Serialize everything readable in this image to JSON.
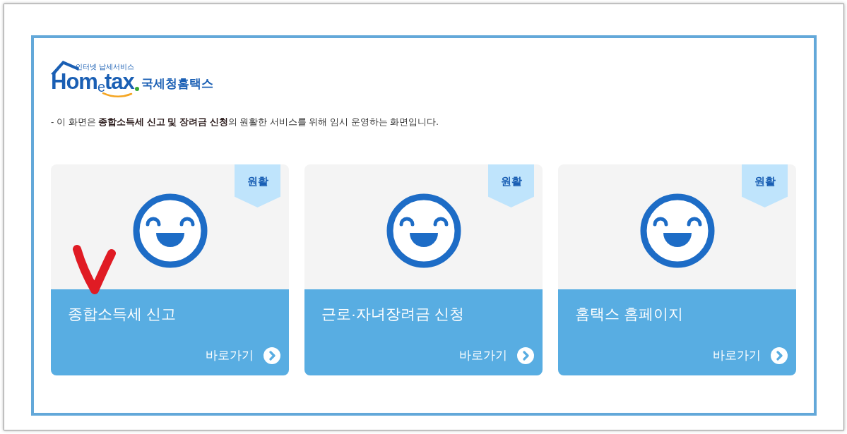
{
  "logo": {
    "tagline": "인터넷 납세서비스",
    "wordmark": "Hom$_{e}$tax",
    "name": "국세청홈택스"
  },
  "notice": "- 이 화면은 **종합소득세 신고 및 장려금 신청**의 원활한 서비스를 위해 임시 운영하는 화면입니다.",
  "cards": [
    {
      "badge": "원활",
      "title": "종합소득세 신고",
      "link": "바로가기",
      "marked": true
    },
    {
      "badge": "원활",
      "title": "근로·자녀장려금 신청",
      "link": "바로가기",
      "marked": false
    },
    {
      "badge": "원활",
      "title": "홈택스 홈페이지",
      "link": "바로가기",
      "marked": false
    }
  ]
}
